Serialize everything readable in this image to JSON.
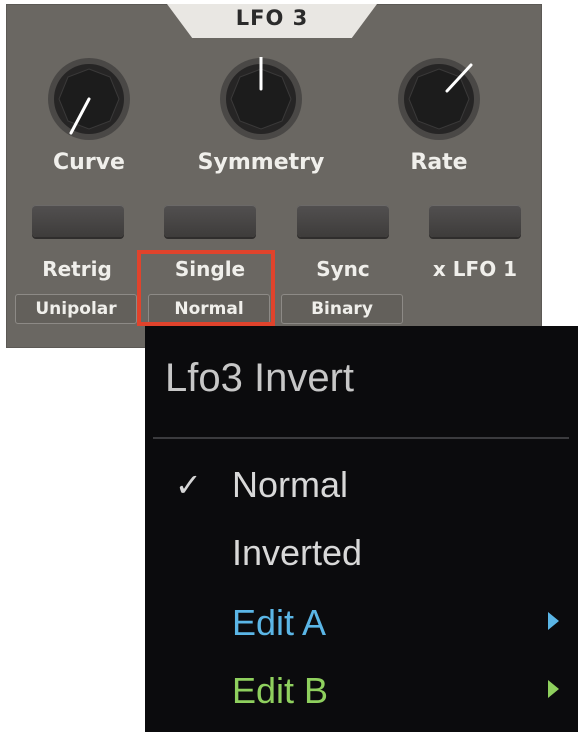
{
  "panel": {
    "title": "LFO 3",
    "knobs": [
      {
        "label": "Curve"
      },
      {
        "label": "Symmetry"
      },
      {
        "label": "Rate"
      }
    ],
    "buttons": [
      {
        "label": "Retrig",
        "sub": "Unipolar"
      },
      {
        "label": "Single",
        "sub": "Normal"
      },
      {
        "label": "Sync",
        "sub": "Binary"
      },
      {
        "label": "x LFO 1",
        "sub": ""
      }
    ]
  },
  "menu": {
    "title": "Lfo3 Invert",
    "items": [
      {
        "label": "Normal",
        "checked": true,
        "color": "#d8d8d8"
      },
      {
        "label": "Inverted",
        "checked": false,
        "color": "#d8d8d8"
      },
      {
        "label": "Edit A",
        "submenu": true,
        "color": "#5bb6e6"
      },
      {
        "label": "Edit B",
        "submenu": true,
        "color": "#8fd05e"
      }
    ],
    "check_glyph": "✓"
  },
  "colors": {
    "panel_bg": "#6a6762",
    "highlight": "#e0432c",
    "menu_bg": "#0b0b0d",
    "edit_a": "#5bb6e6",
    "edit_b": "#8fd05e"
  }
}
